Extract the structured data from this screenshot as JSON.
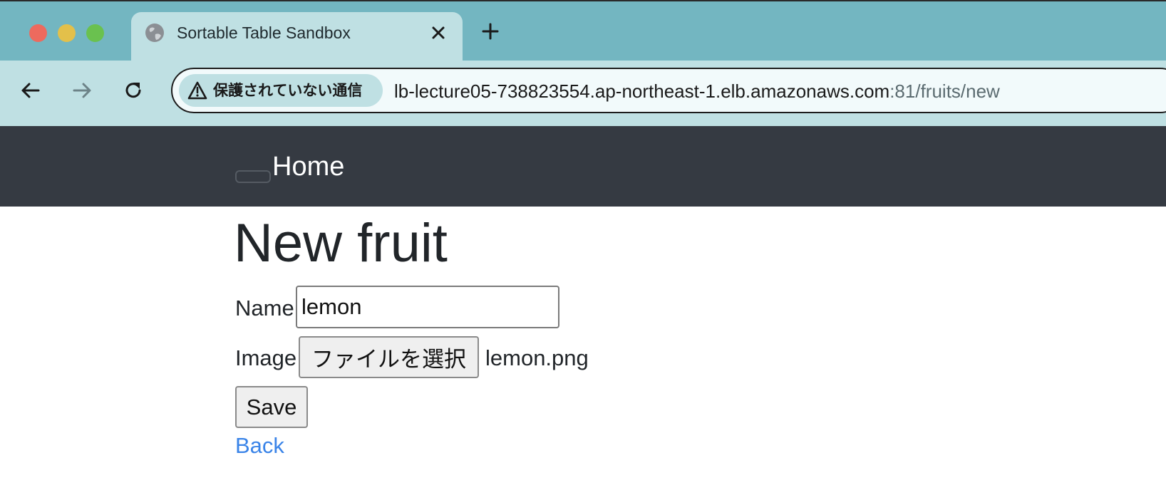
{
  "browser": {
    "tab": {
      "title": "Sortable Table Sandbox"
    },
    "address_bar": {
      "security_label": "保護されていない通信",
      "host": "lb-lecture05-738823554.ap-northeast-1.elb.amazonaws.com",
      "path": ":81/fruits/new"
    },
    "icons": {
      "tab_favicon": "globe-icon",
      "tab_close": "close-icon",
      "new_tab": "plus-icon",
      "back": "arrow-left-icon",
      "forward": "arrow-right-icon",
      "reload": "reload-icon",
      "security": "warning-triangle-icon"
    }
  },
  "navbar": {
    "brand": "Home"
  },
  "main": {
    "title": "New fruit",
    "form": {
      "name_label": "Name",
      "name_value": "lemon",
      "image_label": "Image",
      "file_button_label": "ファイルを選択",
      "file_name": "lemon.png",
      "submit_label": "Save"
    },
    "back_link": "Back"
  },
  "colors": {
    "tabstrip_bg": "#73b6c1",
    "toolbar_bg": "#bfe0e3",
    "navbar_bg": "#353a42",
    "link": "#3a84e8",
    "heading": "#212529"
  }
}
